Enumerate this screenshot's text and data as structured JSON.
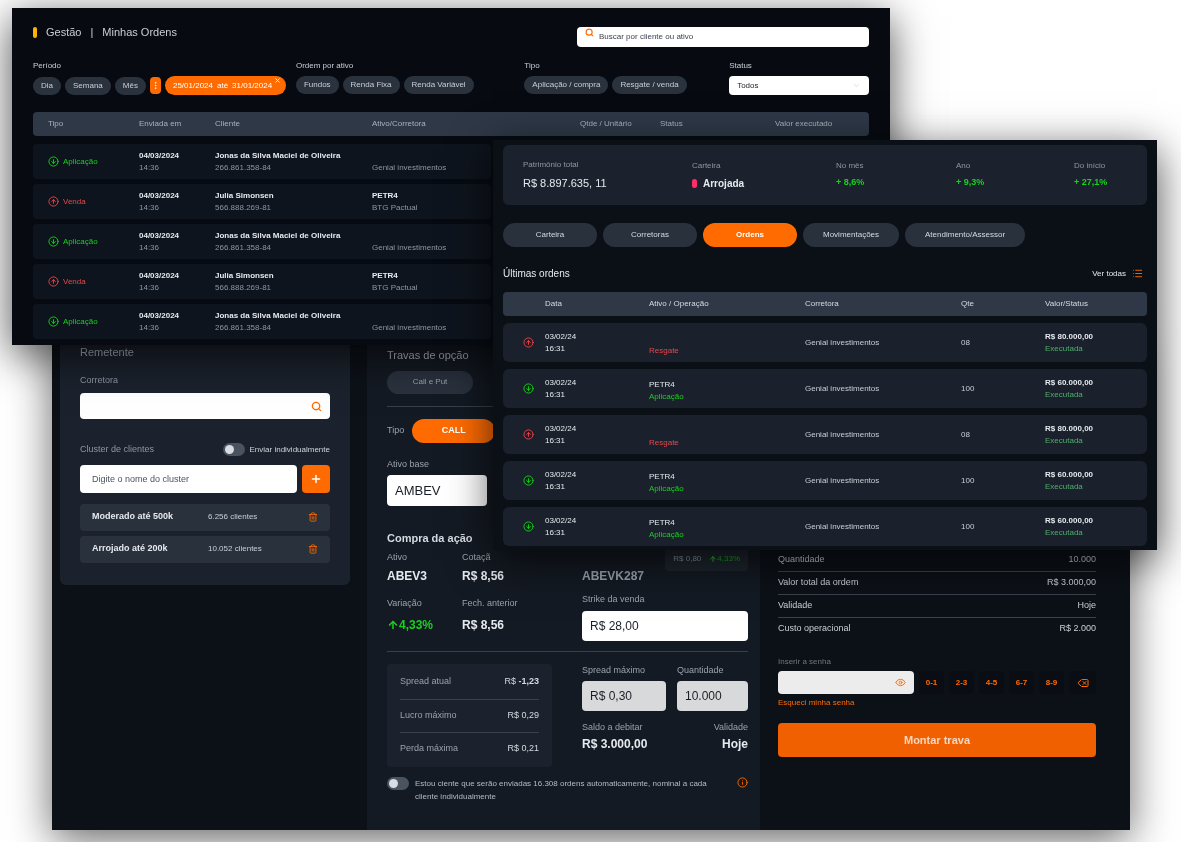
{
  "trade_window": {
    "sender": {
      "title": "Remetente",
      "broker_label": "Corretora",
      "cluster_label": "Cluster de clientes",
      "individual_toggle": {
        "label": "Enviar individualmente",
        "on": false
      },
      "cluster_input": {
        "placeholder": "Digite o nome do cluster"
      },
      "clusters": [
        {
          "name": "Moderado até 500k",
          "count": "6.256 clientes"
        },
        {
          "name": "Arrojado até 200k",
          "count": "10.052 clientes"
        }
      ]
    },
    "lock": {
      "title": "Travas de opção",
      "lock_types": [
        {
          "label": "Call e Put"
        }
      ],
      "type_label": "Tipo",
      "types": [
        {
          "label": "CALL",
          "selected": true
        }
      ],
      "base_asset_label": "Ativo base",
      "base_asset": "AMBEV",
      "purchase_title": "Compra da ação",
      "asset_label": "Ativo",
      "asset": "ABEV3",
      "quote_label": "Cotaçã",
      "quote": "R$ 8,56",
      "variation_label": "Variação",
      "variation": "4,33%",
      "prev_close_label": "Fech. anterior",
      "prev_close": "R$ 8,56",
      "option_asset": "ABEVK287",
      "option_price": "R$ 0,80",
      "option_change": "4,33%",
      "strike_label": "Strike da venda",
      "strike": "R$ 28,00",
      "spread_rows": [
        {
          "label": "Spread atual",
          "value": "R$ **-1,23**"
        },
        {
          "label": "Lucro máximo",
          "value": "R$ 0,29"
        },
        {
          "label": "Perda máxima",
          "value": "R$ 0,21"
        }
      ],
      "max_spread_label": "Spread máximo",
      "max_spread": "R$ 0,30",
      "quantity_label": "Quantidade",
      "quantity": "10.000",
      "debit_label": "Saldo a debitar",
      "debit": "R$ 3.000,00",
      "validity_label": "Validade",
      "validity": "Hoje",
      "consent": {
        "on": false,
        "text": "Estou ciente que serão enviadas  16.308 ordens automaticamente, nominal a cada cliente individualmente"
      }
    },
    "summary": {
      "rows": [
        {
          "label": "Quantidade",
          "value": "10.000"
        },
        {
          "label": "Valor total da ordem",
          "value": "R$ 3.000,00"
        },
        {
          "label": "Validade",
          "value": "Hoje"
        },
        {
          "label": "Custo operacional",
          "value": "R$ 2.000"
        }
      ],
      "password_label": "Inserir a senha",
      "keys": [
        "0-1",
        "2-3",
        "4-5",
        "6-7",
        "8-9"
      ],
      "forgot": "Esqueci minha senha",
      "submit": "Montar trava"
    }
  },
  "orders_window": {
    "section": "Gestão",
    "separator": "|",
    "title": "Minhas Ordens",
    "search": {
      "placeholder": "Buscar por cliente ou ativo"
    },
    "filters": [
      {
        "label": "Período",
        "chips": [
          "Dia",
          "Semana",
          "Mês"
        ]
      },
      {
        "label": "Ordem por ativo",
        "chips": [
          "Fundos",
          "Renda Fixa",
          "Renda Variável"
        ]
      },
      {
        "label": "Tipo",
        "chips": [
          "Aplicação / compra",
          "Resgate / venda"
        ]
      }
    ],
    "date_range": {
      "from": "25/01/2024",
      "sep": "até",
      "to": "31/01/2024"
    },
    "status": {
      "label": "Status",
      "value": "Todos"
    },
    "columns": [
      "Tipo",
      "Enviada em",
      "Cliente",
      "Ativo/Corretora",
      "Qtde /  Unitário",
      "Status",
      "Valor executado"
    ],
    "rows": [
      {
        "kind": "in",
        "type": "Aplicação",
        "date": "04/03/2024",
        "time": "14:36",
        "client": "Jonas da Silva Maciel de Oliveira",
        "doc": "266.861.358-84",
        "broker": "Genial investimentos"
      },
      {
        "kind": "out",
        "type": "Venda",
        "date": "04/03/2024",
        "time": "14:36",
        "client": "Julia Simonsen",
        "doc": "566.888.269-81",
        "asset": "PETR4",
        "broker": "BTG Pactual"
      },
      {
        "kind": "in",
        "type": "Aplicação",
        "date": "04/03/2024",
        "time": "14:36",
        "client": "Jonas da Silva Maciel de Oliveira",
        "doc": "266.861.358-84",
        "broker": "Genial investimentos"
      },
      {
        "kind": "out",
        "type": "Venda",
        "date": "04/03/2024",
        "time": "14:36",
        "client": "Julia Simonsen",
        "doc": "566.888.269-81",
        "asset": "PETR4",
        "broker": "BTG Pactual"
      },
      {
        "kind": "in",
        "type": "Aplicação",
        "date": "04/03/2024",
        "time": "14:36",
        "client": "Jonas da Silva Maciel de Oliveira",
        "doc": "266.861.358-84",
        "broker": "Genial investimentos"
      }
    ]
  },
  "portfolio_window": {
    "stats": [
      {
        "label": "Patrimônio total",
        "value": "R$ 8.897.635, 11",
        "kind": "plain"
      },
      {
        "label": "Carteira",
        "value": "Arrojada",
        "kind": "profile",
        "color": "#ff2d6a"
      },
      {
        "label": "No mês",
        "value": "+ 8,6%",
        "kind": "gain"
      },
      {
        "label": "Ano",
        "value": "+ 9,3%",
        "kind": "gain"
      },
      {
        "label": "Do início",
        "value": "+ 27,1%",
        "kind": "gain"
      }
    ],
    "tabs": [
      {
        "label": "Carteira",
        "selected": false
      },
      {
        "label": "Corretoras",
        "selected": false
      },
      {
        "label": "Ordens",
        "selected": true
      },
      {
        "label": "Movimentações",
        "selected": false
      },
      {
        "label": "Atendimento/Assessor",
        "selected": false
      }
    ],
    "section_title": "Últimas ordens",
    "see_all": "Ver todas",
    "columns": [
      "Data",
      "Ativo / Operação",
      "Corretora",
      "Qte",
      "Valor/Status"
    ],
    "rows": [
      {
        "kind": "out",
        "date": "03/02/24",
        "time": "16:31",
        "operation": "Resgate",
        "broker": "Genial investimentos",
        "qty": "08",
        "value": "R$ 80.000,00",
        "status": "Executada"
      },
      {
        "kind": "in",
        "date": "03/02/24",
        "time": "16:31",
        "asset": "PETR4",
        "operation": "Aplicação",
        "broker": "Genial investimentos",
        "qty": "100",
        "value": "R$ 60.000,00",
        "status": "Executada"
      },
      {
        "kind": "out",
        "date": "03/02/24",
        "time": "16:31",
        "operation": "Resgate",
        "broker": "Genial investimentos",
        "qty": "08",
        "value": "R$ 80.000,00",
        "status": "Executada"
      },
      {
        "kind": "in",
        "date": "03/02/24",
        "time": "16:31",
        "asset": "PETR4",
        "operation": "Aplicação",
        "broker": "Genial investimentos",
        "qty": "100",
        "value": "R$ 60.000,00",
        "status": "Executada"
      },
      {
        "kind": "in",
        "date": "03/02/24",
        "time": "16:31",
        "asset": "PETR4",
        "operation": "Aplicação",
        "broker": "Genial investimentos",
        "qty": "100",
        "value": "R$ 60.000,00",
        "status": "Executada"
      }
    ]
  }
}
